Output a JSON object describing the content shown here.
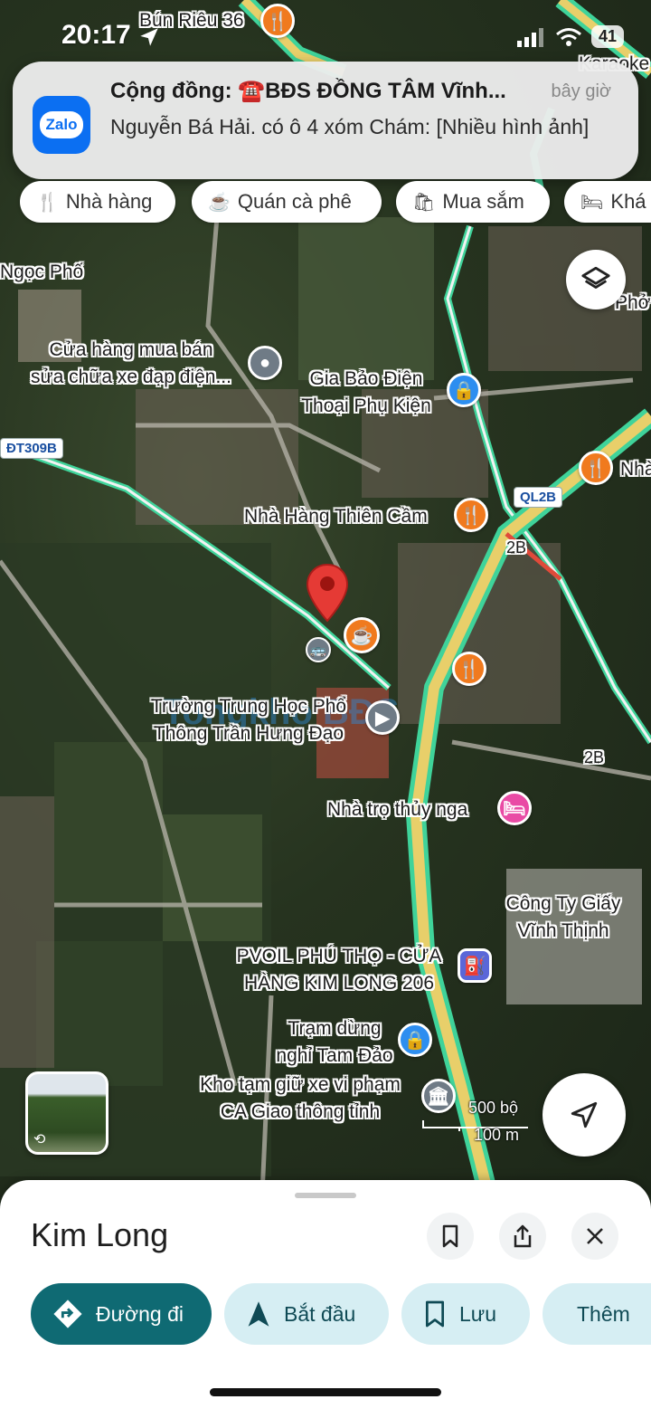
{
  "status_bar": {
    "time": "20:17",
    "battery": "41"
  },
  "notification": {
    "app_name": "Zalo",
    "title": "Cộng đồng: ☎️BĐS ĐỒNG TÂM Vĩnh...",
    "time": "bây giờ",
    "body": "Nguyễn Bá Hải. có ô 4 xóm Chám: [Nhiều hình ảnh]"
  },
  "chips": [
    {
      "label": "Nhà hàng",
      "icon": "fork-knife-icon"
    },
    {
      "label": "Quán cà phê",
      "icon": "coffee-cup-icon"
    },
    {
      "label": "Mua sắm",
      "icon": "shopping-bag-icon"
    },
    {
      "label": "Khá",
      "icon": "bed-icon"
    }
  ],
  "map_labels": {
    "bun_rieu": "Bún Riêu 36",
    "karaoke": "Karaoke",
    "ngoc_pho": "Ngọc Phố",
    "pho": "Phở",
    "xe_dap_1": "Cửa hàng mua bán",
    "xe_dap_2": "sửa chữa xe đạp điện...",
    "gia_bao_1": "Gia Bảo Điện",
    "gia_bao_2": "Thoại Phụ Kiện",
    "nha": "Nhà",
    "thien_cam": "Nhà Hàng Thiên Cầm",
    "truong_1": "Trường Trung Học Phổ",
    "truong_2": "Thông Trần Hưng Đạo",
    "nha_tro": "Nhà trọ thủy nga",
    "cong_ty_1": "Công Ty Giấy",
    "cong_ty_2": "Vĩnh Thịnh",
    "pvoil_1": "PVOIL PHÚ THỌ - CỬA",
    "pvoil_2": "HÀNG KIM LONG 206",
    "tram_dung_1": "Trạm dừng",
    "tram_dung_2": "nghỉ Tam Đảo",
    "kho_1": "Kho tạm giữ xe vi phạm",
    "kho_2": "CA Giao thông tỉnh",
    "road_dt309b": "ĐT309B",
    "road_ql2b": "QL2B",
    "road_2b": "2B"
  },
  "scale": {
    "imperial": "500 bộ",
    "metric": "100 m"
  },
  "place": {
    "title": "Kim Long"
  },
  "actions": [
    {
      "label": "Đường đi"
    },
    {
      "label": "Bắt đầu"
    },
    {
      "label": "Lưu"
    },
    {
      "label": "Thêm"
    }
  ]
}
